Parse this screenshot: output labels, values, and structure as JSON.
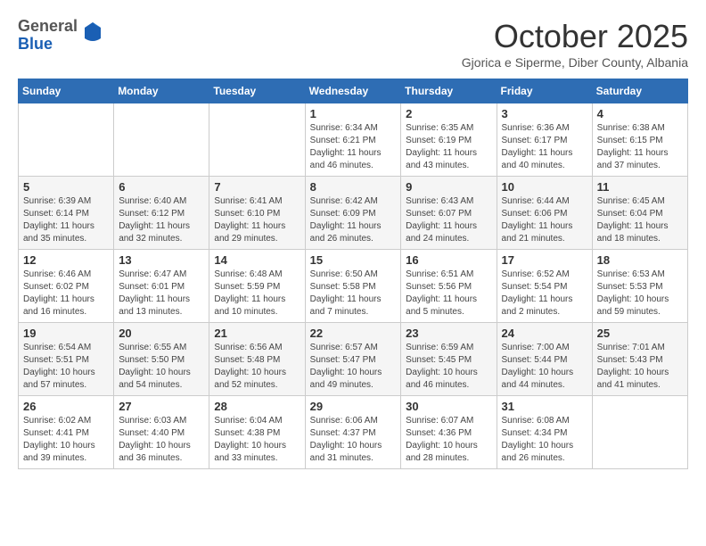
{
  "logo": {
    "line1": "General",
    "line2": "Blue"
  },
  "title": "October 2025",
  "subtitle": "Gjorica e Siperme, Diber County, Albania",
  "days_header": [
    "Sunday",
    "Monday",
    "Tuesday",
    "Wednesday",
    "Thursday",
    "Friday",
    "Saturday"
  ],
  "weeks": [
    [
      {
        "day": "",
        "info": ""
      },
      {
        "day": "",
        "info": ""
      },
      {
        "day": "",
        "info": ""
      },
      {
        "day": "1",
        "info": "Sunrise: 6:34 AM\nSunset: 6:21 PM\nDaylight: 11 hours\nand 46 minutes."
      },
      {
        "day": "2",
        "info": "Sunrise: 6:35 AM\nSunset: 6:19 PM\nDaylight: 11 hours\nand 43 minutes."
      },
      {
        "day": "3",
        "info": "Sunrise: 6:36 AM\nSunset: 6:17 PM\nDaylight: 11 hours\nand 40 minutes."
      },
      {
        "day": "4",
        "info": "Sunrise: 6:38 AM\nSunset: 6:15 PM\nDaylight: 11 hours\nand 37 minutes."
      }
    ],
    [
      {
        "day": "5",
        "info": "Sunrise: 6:39 AM\nSunset: 6:14 PM\nDaylight: 11 hours\nand 35 minutes."
      },
      {
        "day": "6",
        "info": "Sunrise: 6:40 AM\nSunset: 6:12 PM\nDaylight: 11 hours\nand 32 minutes."
      },
      {
        "day": "7",
        "info": "Sunrise: 6:41 AM\nSunset: 6:10 PM\nDaylight: 11 hours\nand 29 minutes."
      },
      {
        "day": "8",
        "info": "Sunrise: 6:42 AM\nSunset: 6:09 PM\nDaylight: 11 hours\nand 26 minutes."
      },
      {
        "day": "9",
        "info": "Sunrise: 6:43 AM\nSunset: 6:07 PM\nDaylight: 11 hours\nand 24 minutes."
      },
      {
        "day": "10",
        "info": "Sunrise: 6:44 AM\nSunset: 6:06 PM\nDaylight: 11 hours\nand 21 minutes."
      },
      {
        "day": "11",
        "info": "Sunrise: 6:45 AM\nSunset: 6:04 PM\nDaylight: 11 hours\nand 18 minutes."
      }
    ],
    [
      {
        "day": "12",
        "info": "Sunrise: 6:46 AM\nSunset: 6:02 PM\nDaylight: 11 hours\nand 16 minutes."
      },
      {
        "day": "13",
        "info": "Sunrise: 6:47 AM\nSunset: 6:01 PM\nDaylight: 11 hours\nand 13 minutes."
      },
      {
        "day": "14",
        "info": "Sunrise: 6:48 AM\nSunset: 5:59 PM\nDaylight: 11 hours\nand 10 minutes."
      },
      {
        "day": "15",
        "info": "Sunrise: 6:50 AM\nSunset: 5:58 PM\nDaylight: 11 hours\nand 7 minutes."
      },
      {
        "day": "16",
        "info": "Sunrise: 6:51 AM\nSunset: 5:56 PM\nDaylight: 11 hours\nand 5 minutes."
      },
      {
        "day": "17",
        "info": "Sunrise: 6:52 AM\nSunset: 5:54 PM\nDaylight: 11 hours\nand 2 minutes."
      },
      {
        "day": "18",
        "info": "Sunrise: 6:53 AM\nSunset: 5:53 PM\nDaylight: 10 hours\nand 59 minutes."
      }
    ],
    [
      {
        "day": "19",
        "info": "Sunrise: 6:54 AM\nSunset: 5:51 PM\nDaylight: 10 hours\nand 57 minutes."
      },
      {
        "day": "20",
        "info": "Sunrise: 6:55 AM\nSunset: 5:50 PM\nDaylight: 10 hours\nand 54 minutes."
      },
      {
        "day": "21",
        "info": "Sunrise: 6:56 AM\nSunset: 5:48 PM\nDaylight: 10 hours\nand 52 minutes."
      },
      {
        "day": "22",
        "info": "Sunrise: 6:57 AM\nSunset: 5:47 PM\nDaylight: 10 hours\nand 49 minutes."
      },
      {
        "day": "23",
        "info": "Sunrise: 6:59 AM\nSunset: 5:45 PM\nDaylight: 10 hours\nand 46 minutes."
      },
      {
        "day": "24",
        "info": "Sunrise: 7:00 AM\nSunset: 5:44 PM\nDaylight: 10 hours\nand 44 minutes."
      },
      {
        "day": "25",
        "info": "Sunrise: 7:01 AM\nSunset: 5:43 PM\nDaylight: 10 hours\nand 41 minutes."
      }
    ],
    [
      {
        "day": "26",
        "info": "Sunrise: 6:02 AM\nSunset: 4:41 PM\nDaylight: 10 hours\nand 39 minutes."
      },
      {
        "day": "27",
        "info": "Sunrise: 6:03 AM\nSunset: 4:40 PM\nDaylight: 10 hours\nand 36 minutes."
      },
      {
        "day": "28",
        "info": "Sunrise: 6:04 AM\nSunset: 4:38 PM\nDaylight: 10 hours\nand 33 minutes."
      },
      {
        "day": "29",
        "info": "Sunrise: 6:06 AM\nSunset: 4:37 PM\nDaylight: 10 hours\nand 31 minutes."
      },
      {
        "day": "30",
        "info": "Sunrise: 6:07 AM\nSunset: 4:36 PM\nDaylight: 10 hours\nand 28 minutes."
      },
      {
        "day": "31",
        "info": "Sunrise: 6:08 AM\nSunset: 4:34 PM\nDaylight: 10 hours\nand 26 minutes."
      },
      {
        "day": "",
        "info": ""
      }
    ]
  ]
}
